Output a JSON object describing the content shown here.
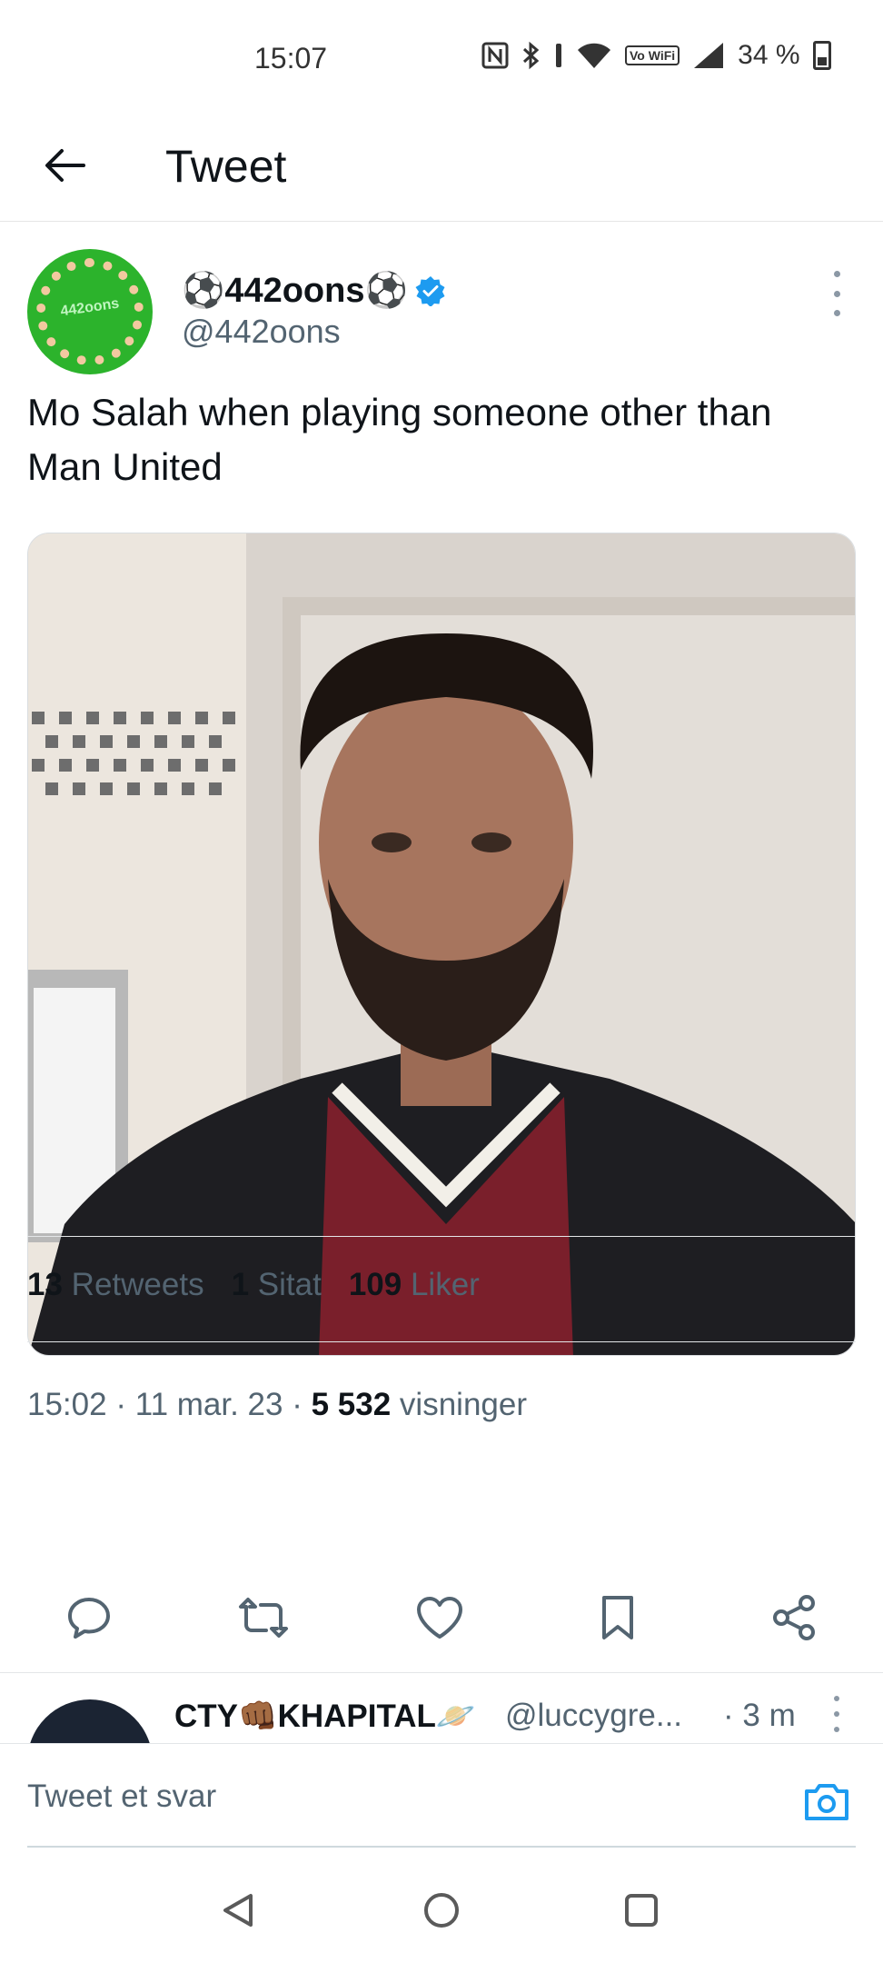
{
  "status_bar": {
    "time": "15:07",
    "icons": [
      "nfc-icon",
      "bluetooth-icon",
      "vibrate-icon",
      "wifi-icon",
      "vowifi-icon",
      "signal-icon",
      "battery-icon"
    ],
    "vowifi_label": "Vo WiFi",
    "battery": "34 %"
  },
  "header": {
    "title": "Tweet"
  },
  "tweet": {
    "author_name": "⚽442oons⚽",
    "author_handle": "@442oons",
    "avatar_text": "442oons",
    "text": "Mo Salah when playing someone other than Man United",
    "time": "15:02",
    "date": "11 mar. 23",
    "views_count": "5 532",
    "views_label": "visninger",
    "retweets_count": "13",
    "retweets_label": "Retweets",
    "quotes_count": "1",
    "quotes_label": "Sitat",
    "likes_count": "109",
    "likes_label": "Liker",
    "separator": " · "
  },
  "reply_preview": {
    "name": "CTY👊🏾KHAPITAL🪐",
    "handle": "@luccygre...",
    "time": "· 3 m"
  },
  "compose": {
    "placeholder": "Tweet et svar"
  },
  "colors": {
    "accent": "#1d9bf0",
    "text": "#0f1419",
    "muted": "#536471",
    "avatar_green": "#2cb32c"
  }
}
